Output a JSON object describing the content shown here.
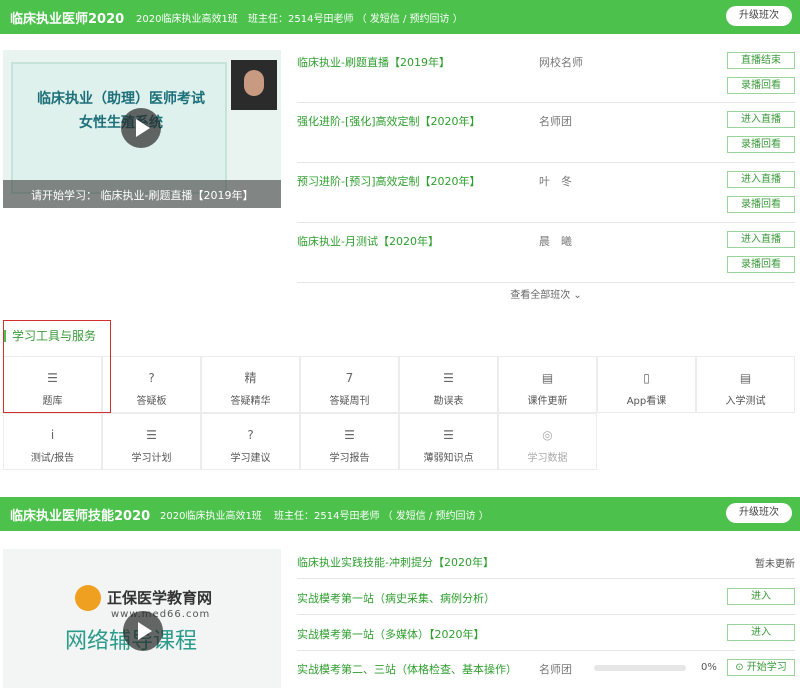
{
  "sec1": {
    "title": "临床执业医师2020",
    "class_name": "2020临床执业高效1班",
    "teacher": "班主任：2514号田老师 （ 发短信 / 预约回访 ）",
    "upgrade": "升级班次",
    "video_caption": "请开始学习： 临床执业-刷题直播【2019年】",
    "video_slide_title": "临床执业（助理）医师考试",
    "video_slide_sub": "女性生殖系统",
    "courses": [
      {
        "name": "临床执业-刷题直播【2019年】",
        "teacher": "网校名师",
        "btn1": "直播结束",
        "btn2": "录播回看"
      },
      {
        "name": "强化进阶-[强化]高效定制【2020年】",
        "teacher": "名师团",
        "btn1": "进入直播",
        "btn2": "录播回看"
      },
      {
        "name": "预习进阶-[预习]高效定制【2020年】",
        "teacher": "叶　冬",
        "btn1": "进入直播",
        "btn2": "录播回看"
      },
      {
        "name": "临床执业-月测试【2020年】",
        "teacher": "晨　曦",
        "btn1": "进入直播",
        "btn2": "录播回看"
      }
    ],
    "view_all": "查看全部班次 ⌄"
  },
  "tools": {
    "title": "学习工具与服务",
    "items": [
      {
        "label": "题库",
        "icon": "☰"
      },
      {
        "label": "答疑板",
        "icon": "?"
      },
      {
        "label": "答疑精华",
        "icon": "精"
      },
      {
        "label": "答疑周刊",
        "icon": "7"
      },
      {
        "label": "勘误表",
        "icon": "☰"
      },
      {
        "label": "课件更新",
        "icon": "▤"
      },
      {
        "label": "App看课",
        "icon": "▯"
      },
      {
        "label": "入学测试",
        "icon": "▤"
      },
      {
        "label": "测试/报告",
        "icon": "i"
      },
      {
        "label": "学习计划",
        "icon": "☰"
      },
      {
        "label": "学习建议",
        "icon": "?"
      },
      {
        "label": "学习报告",
        "icon": "☰"
      },
      {
        "label": "薄弱知识点",
        "icon": "☰"
      },
      {
        "label": "学习数据",
        "icon": "◎"
      }
    ]
  },
  "sec2": {
    "title": "临床执业医师技能2020",
    "class_name": "2020临床执业高效1班",
    "teacher": "班主任：2514号田老师 （ 发短信 / 预约回访 ）",
    "upgrade": "升级班次",
    "brand_name": "正保医学教育网",
    "brand_url": "www.med66.com",
    "banner_text": "网络辅导课程",
    "courses": [
      {
        "name": "临床执业实践技能-冲刺提分【2020年】",
        "teacher": "",
        "status": "暂未更新"
      },
      {
        "name": "实战模考第一站（病史采集、病例分析）",
        "teacher": "",
        "btn": "进入"
      },
      {
        "name": "实战模考第一站（多媒体）【2020年】",
        "teacher": "",
        "btn": "进入"
      },
      {
        "name": "实战模考第二、三站（体格检查、基本操作）",
        "teacher": "名师团",
        "progress": "0%",
        "btn": "⊙ 开始学习"
      }
    ]
  },
  "colors": {
    "accent": "#4cc24c",
    "link": "#2e9e2e",
    "highlight_box": "#d32f2f"
  }
}
